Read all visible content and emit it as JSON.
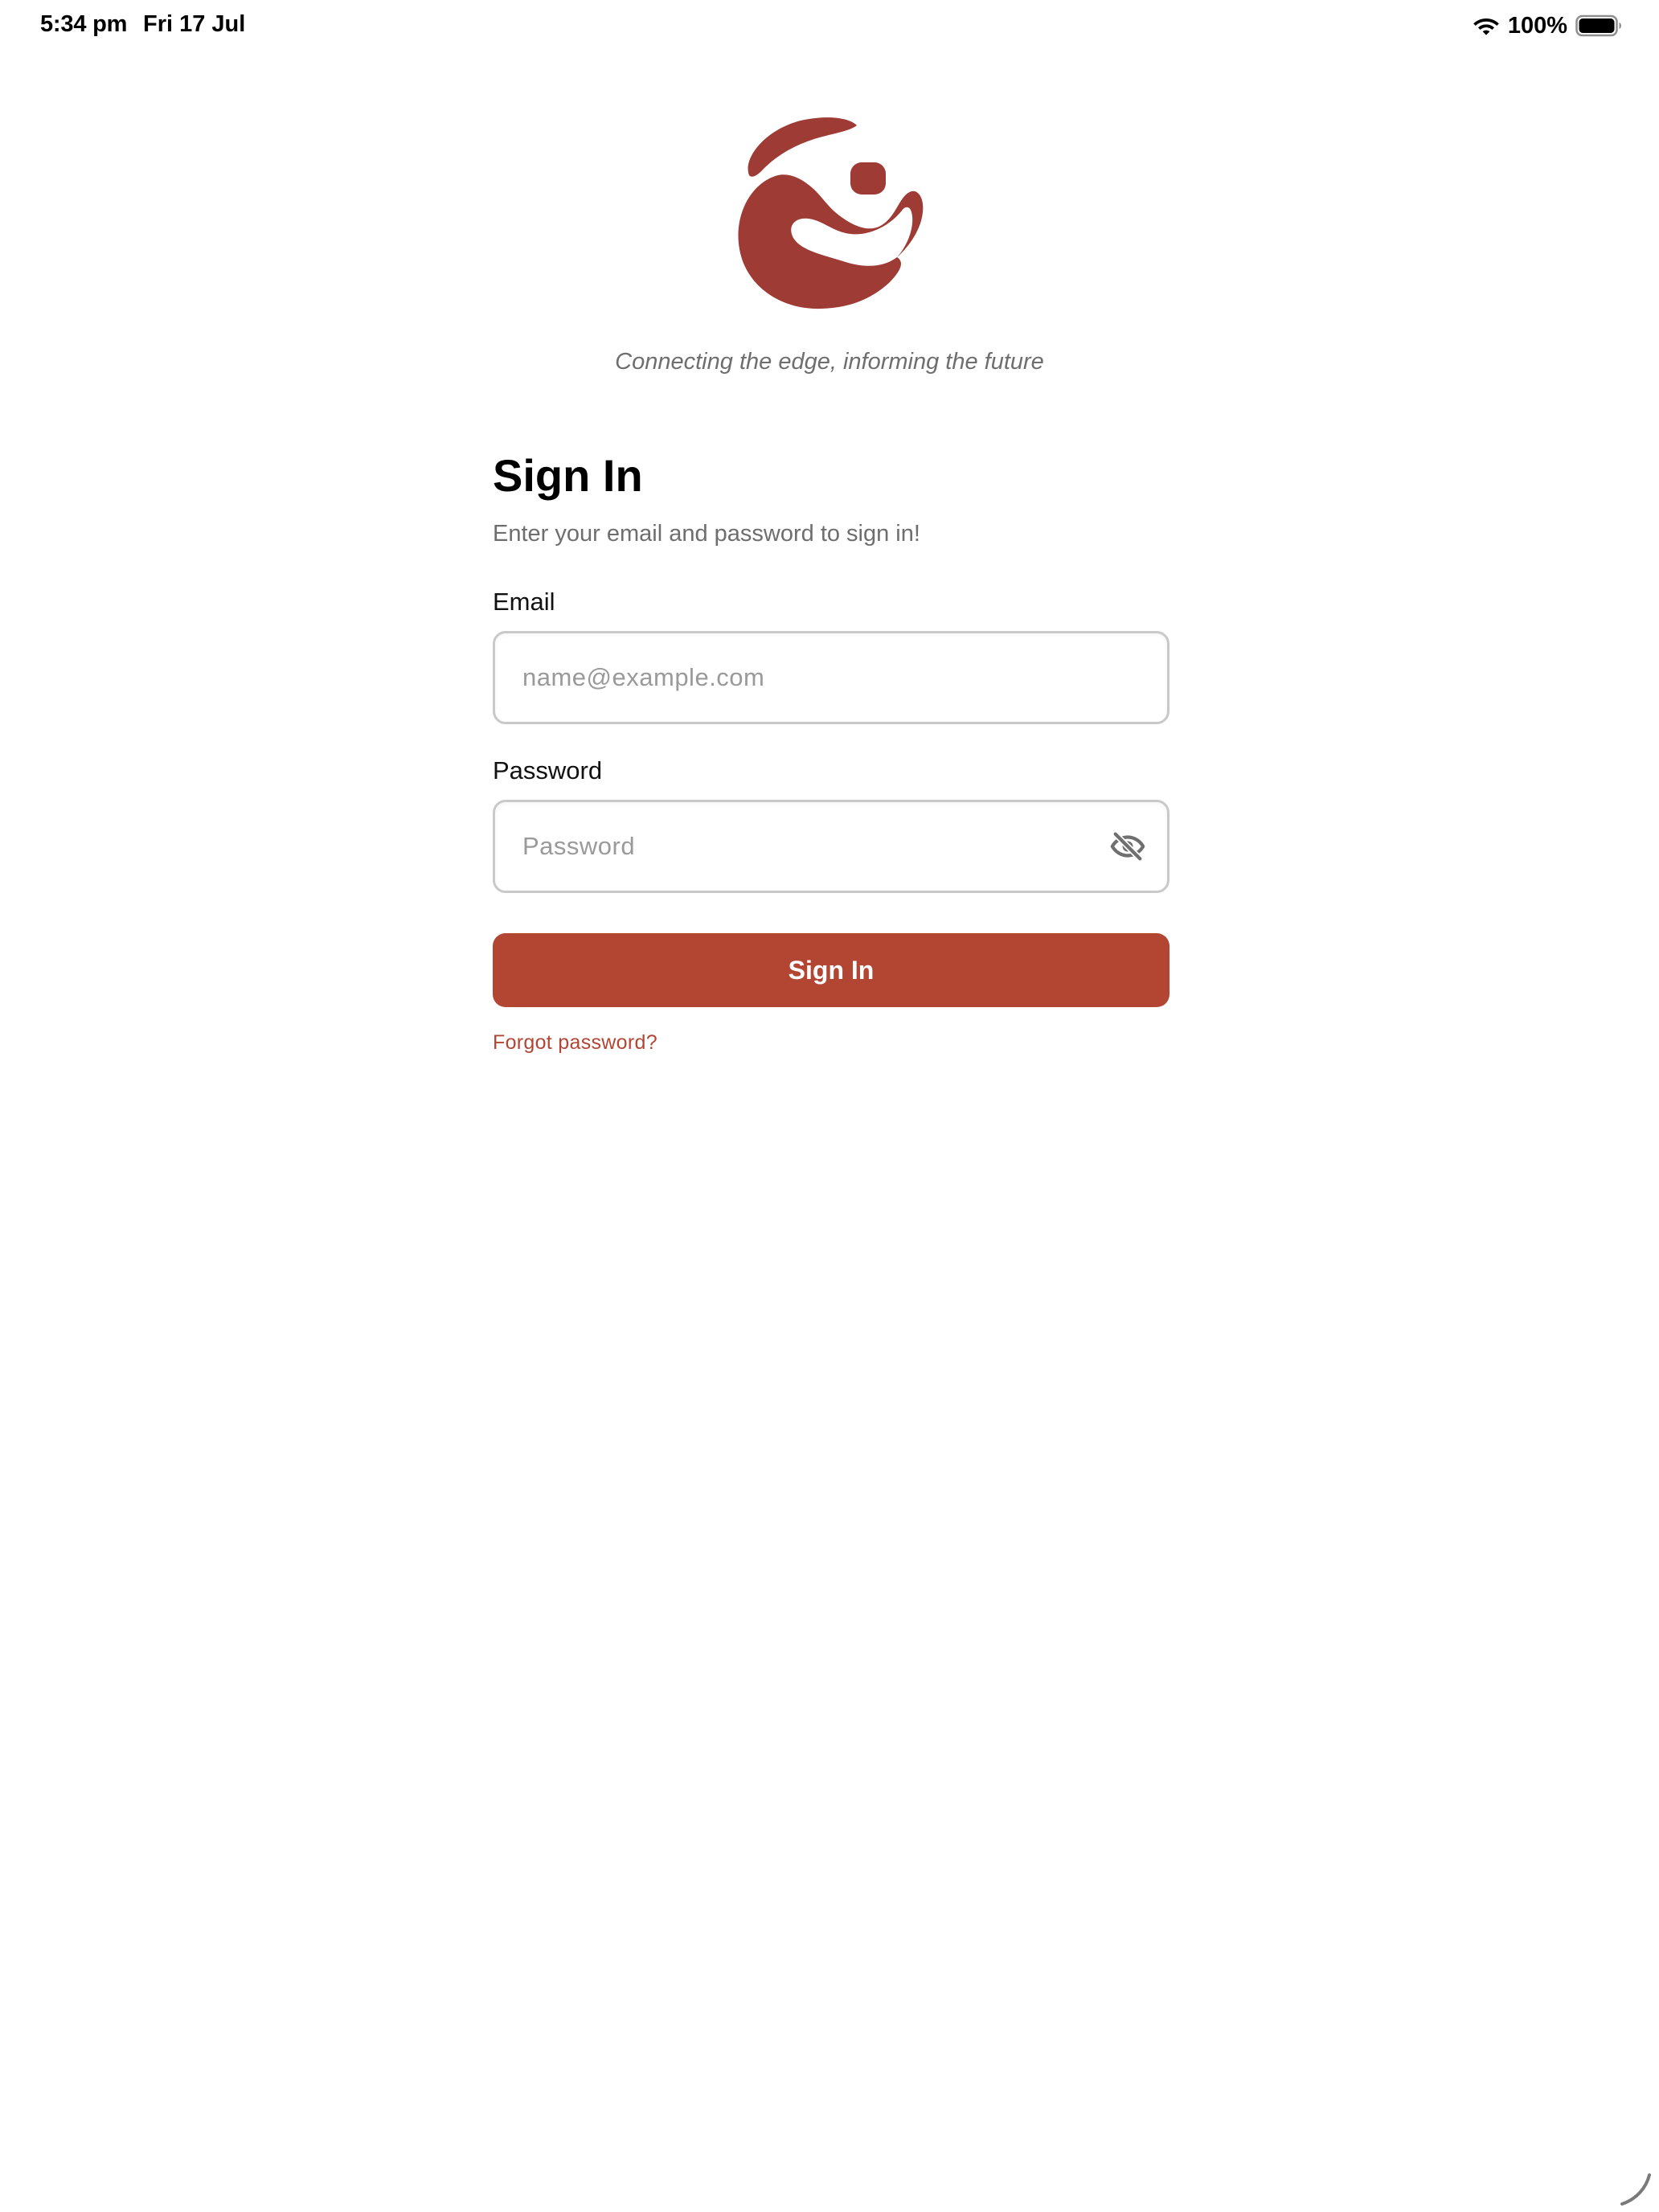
{
  "status_bar": {
    "time": "5:34 pm",
    "date": "Fri 17 Jul",
    "battery_percent": "100%",
    "wifi_icon": "wifi-icon",
    "battery_icon": "battery-icon",
    "battery_level": 1.0
  },
  "brand": {
    "logo_icon": "brand-logo-icon",
    "logo_color": "#9e3b34",
    "tagline": "Connecting the edge, informing the future"
  },
  "sign_in": {
    "title": "Sign In",
    "subtitle": "Enter your email and password to sign in!",
    "email": {
      "label": "Email",
      "value": "",
      "placeholder": "name@example.com"
    },
    "password": {
      "label": "Password",
      "value": "",
      "placeholder": "Password",
      "visibility_icon": "eye-off-icon"
    },
    "submit_label": "Sign In",
    "forgot_password": "Forgot password?"
  },
  "colors": {
    "accent": "#b34533",
    "text_primary": "#000000",
    "text_muted": "#6e6e6e",
    "placeholder": "#9a9a9a",
    "input_border": "#c9c9c9"
  }
}
